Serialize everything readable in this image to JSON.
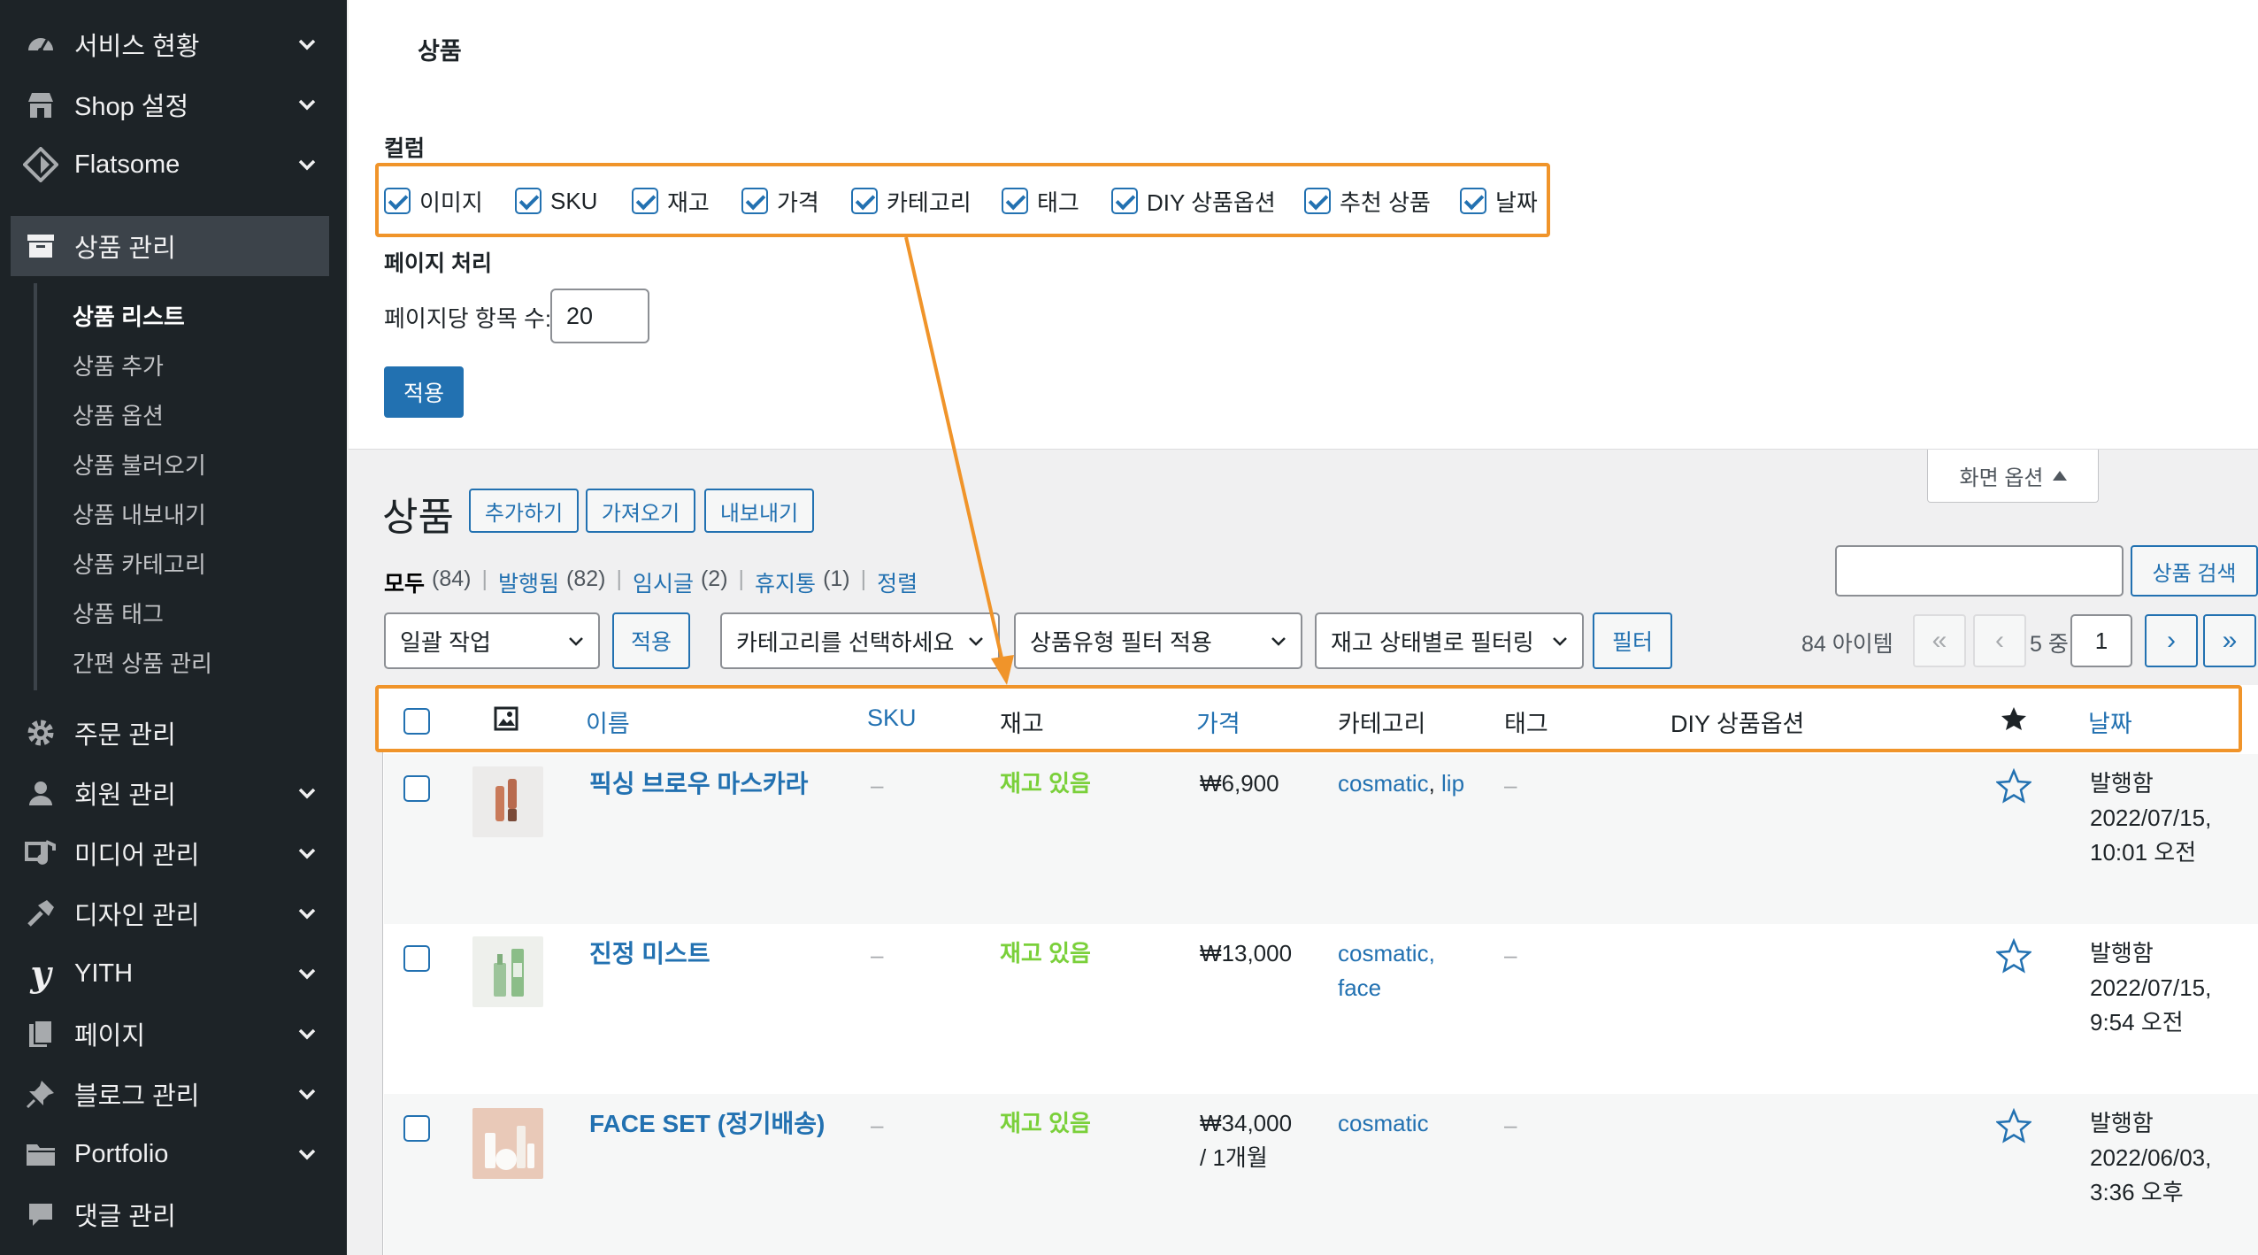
{
  "sidebar": {
    "items": [
      {
        "label": "서비스 현황",
        "icon": "dashboard-icon"
      },
      {
        "label": "Shop 설정",
        "icon": "shop-icon"
      },
      {
        "label": "Flatsome",
        "icon": "flatsome-icon"
      },
      {
        "label": "상품 관리",
        "icon": "archive-icon"
      },
      {
        "label": "주문 관리",
        "icon": "gear-icon"
      },
      {
        "label": "회원 관리",
        "icon": "user-icon"
      },
      {
        "label": "미디어 관리",
        "icon": "media-icon"
      },
      {
        "label": "디자인 관리",
        "icon": "hammer-icon"
      },
      {
        "label": "YITH",
        "icon": "yith-icon"
      },
      {
        "label": "페이지",
        "icon": "page-icon"
      },
      {
        "label": "블로그 관리",
        "icon": "pin-icon"
      },
      {
        "label": "Portfolio",
        "icon": "folder-icon"
      },
      {
        "label": "댓글 관리",
        "icon": "comment-icon"
      }
    ],
    "submenu": [
      "상품 리스트",
      "상품 추가",
      "상품 옵션",
      "상품 불러오기",
      "상품 내보내기",
      "상품 카테고리",
      "상품 태그",
      "간편 상품 관리"
    ]
  },
  "screen_options": {
    "title": "상품",
    "columns_heading": "컬럼",
    "columns": [
      "이미지",
      "SKU",
      "재고",
      "가격",
      "카테고리",
      "태그",
      "DIY 상품옵션",
      "추천 상품",
      "날짜"
    ],
    "pagination_heading": "페이지 처리",
    "per_page_label": "페이지당 항목 수:",
    "per_page_value": "20",
    "apply_label": "적용",
    "tab_label": "화면 옵션"
  },
  "header": {
    "title": "상품",
    "buttons": [
      "추가하기",
      "가져오기",
      "내보내기"
    ]
  },
  "views": {
    "all": "모두",
    "all_count": "(84)",
    "published": "발행됨",
    "published_count": "(82)",
    "draft": "임시글",
    "draft_count": "(2)",
    "trash": "휴지통",
    "trash_count": "(1)",
    "sort": "정렬"
  },
  "search": {
    "button": "상품 검색",
    "value": ""
  },
  "filters": {
    "bulk_action": "일괄 작업",
    "apply": "적용",
    "category": "카테고리를 선택하세요",
    "product_type": "상품유형 필터 적용",
    "stock_status": "재고 상태별로 필터링",
    "filter_btn": "필터"
  },
  "pagination": {
    "items": "84 아이템",
    "first": "«",
    "prev": "‹",
    "next": "›",
    "last": "»",
    "of_text": "5 중",
    "current_page": "1"
  },
  "table": {
    "columns": [
      "이름",
      "SKU",
      "재고",
      "가격",
      "카테고리",
      "태그",
      "DIY 상품옵션",
      "날짜"
    ],
    "rows": [
      {
        "name": "픽싱 브로우 마스카라",
        "sku": "–",
        "stock": "재고 있음",
        "price": "₩6,900",
        "price2": "",
        "cat1": "cosmatic",
        "cat2": "lip",
        "tag": "–",
        "status": "발행함",
        "date": "2022/07/15,",
        "time": "10:01 오전"
      },
      {
        "name": "진정 미스트",
        "sku": "–",
        "stock": "재고 있음",
        "price": "₩13,000",
        "price2": "",
        "cat1": "cosmatic,",
        "cat2": "face",
        "tag": "–",
        "status": "발행함",
        "date": "2022/07/15,",
        "time": "9:54 오전"
      },
      {
        "name": "FACE SET (정기배송)",
        "sku": "–",
        "stock": "재고 있음",
        "price": "₩34,000",
        "price2": "/ 1개월",
        "cat1": "cosmatic",
        "cat2": "",
        "tag": "–",
        "status": "발행함",
        "date": "2022/06/03,",
        "time": "3:36 오후"
      }
    ]
  },
  "colors": {
    "accent": "#2271b1",
    "highlight": "#f0942a",
    "in_stock": "#7ad03a",
    "sidebar": "#1d2327"
  }
}
